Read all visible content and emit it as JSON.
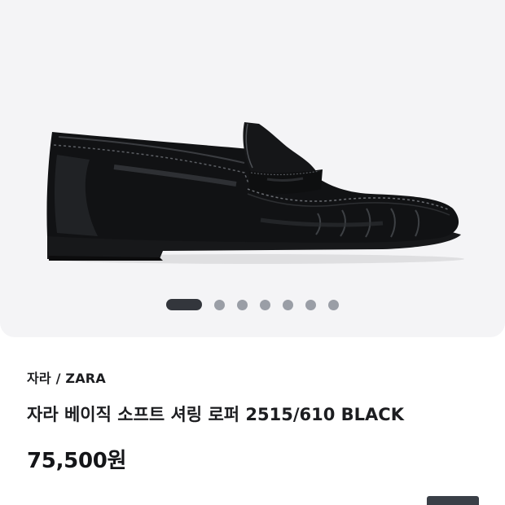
{
  "product": {
    "brand": "자라 / ZARA",
    "title": "자라 베이직 소프트 셔링 로퍼 2515/610 BLACK",
    "price": "75,500원",
    "image_subject": "black leather penny loafer"
  },
  "gallery": {
    "image_count": 7,
    "active_index": 0
  },
  "colors": {
    "gallery_background": "#f4f4f6",
    "dot_active": "#33363c",
    "dot_inactive": "#9a9ea6",
    "text_primary": "#1c1d20"
  }
}
